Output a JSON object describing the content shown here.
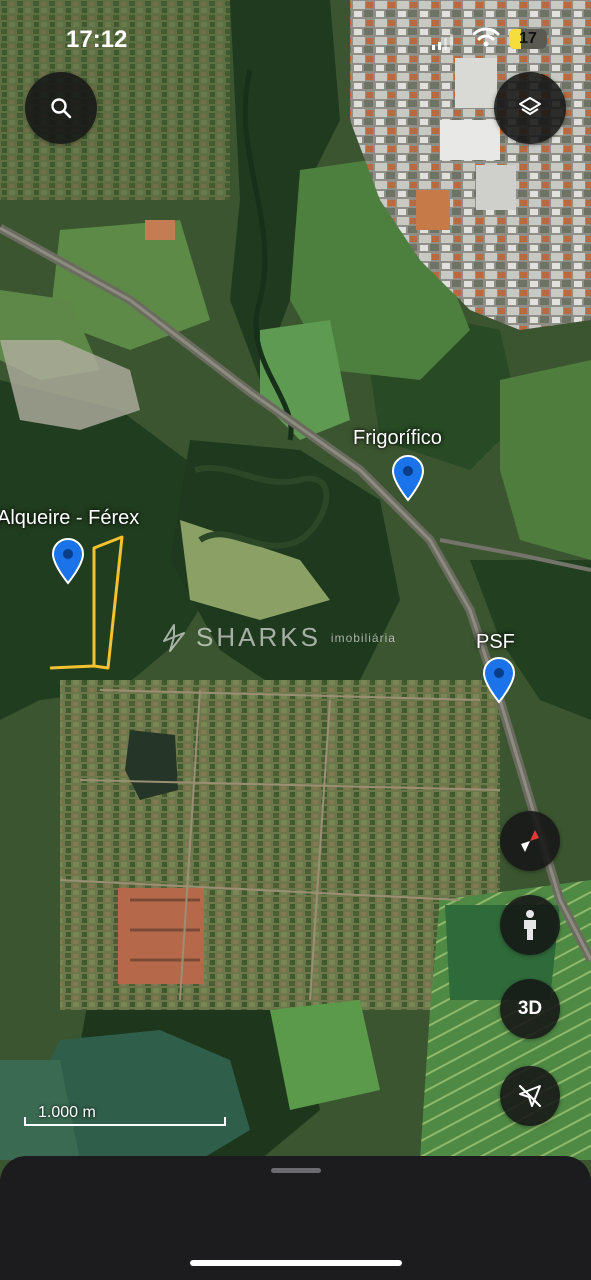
{
  "status_bar": {
    "time": "17:12",
    "battery": "17",
    "battery_color": "#f5de3c"
  },
  "controls": {
    "search_icon": "search-icon",
    "layers_icon": "layers-icon",
    "compass_icon": "compass-icon",
    "street_view_icon": "person-icon",
    "three_d_label": "3D",
    "location_icon": "location-off-icon"
  },
  "markers": [
    {
      "label": "Alqueire - Férex",
      "icon": "map-pin-icon",
      "color": "#1a73e8"
    },
    {
      "label": "Frigorífico",
      "icon": "map-pin-icon",
      "color": "#1a73e8"
    },
    {
      "label": "PSF",
      "icon": "map-pin-icon",
      "color": "#1a73e8"
    }
  ],
  "watermark": {
    "brand": "SHARKS",
    "sub": "imobiliária"
  },
  "scale": {
    "label": "1.000 m"
  },
  "highlight": {
    "color": "#f2c230"
  },
  "colors": {
    "sheet": "#1c1c1e",
    "button": "#161616"
  }
}
